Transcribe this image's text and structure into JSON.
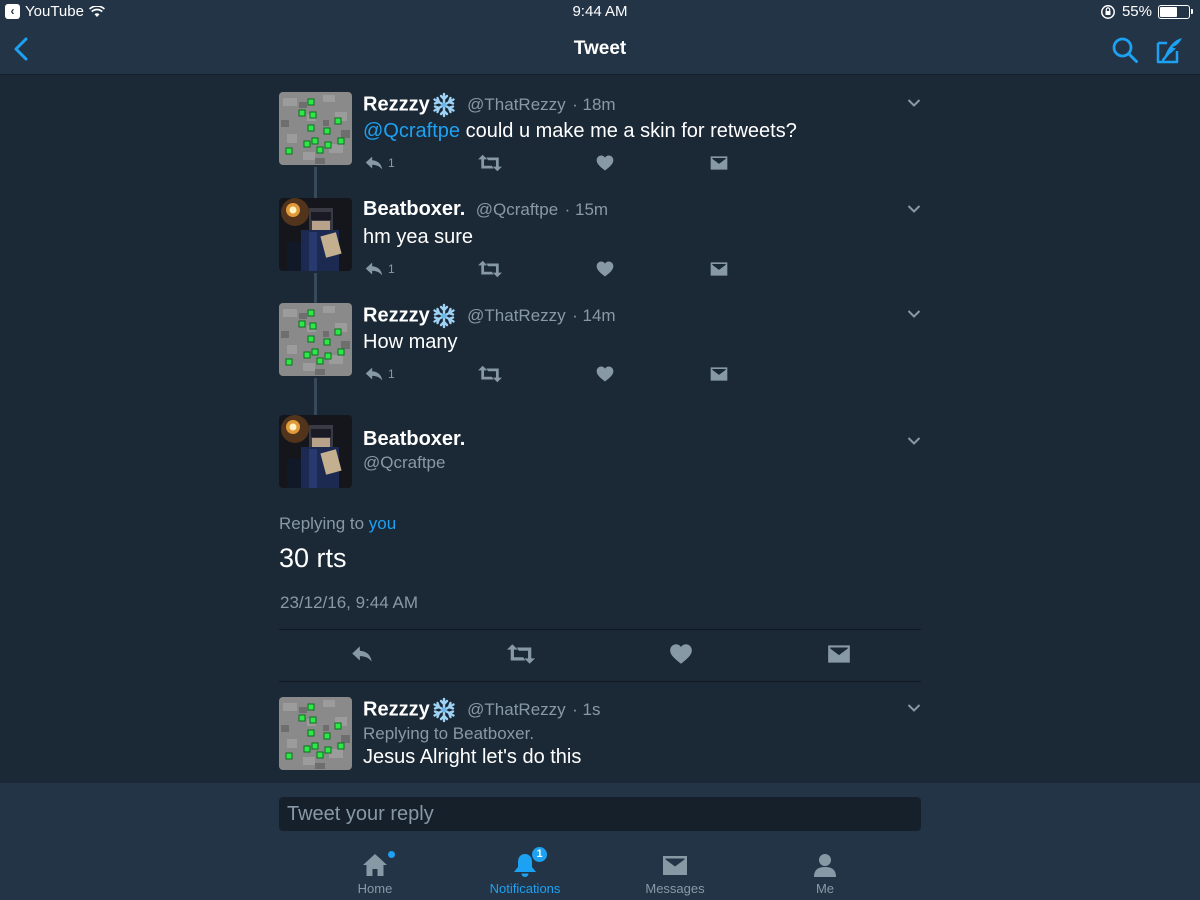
{
  "status_bar": {
    "back_app": "YouTube",
    "time": "9:44 AM",
    "battery": "55%",
    "battery_level": 0.55
  },
  "nav": {
    "title": "Tweet"
  },
  "colors": {
    "accent": "#1da1f2",
    "background": "#1b2836",
    "bar": "#243447",
    "muted": "#8899a6"
  },
  "thread": [
    {
      "name": "Rezzzy",
      "handle": "@ThatRezzy",
      "time": "· 18m",
      "mention": "@Qcraftpe",
      "text": " could u make me a skin for retweets?",
      "reply_count": "1"
    },
    {
      "name": "Beatboxer.",
      "handle": "@Qcraftpe",
      "time": "· 15m",
      "text": "hm yea sure",
      "reply_count": "1"
    },
    {
      "name": "Rezzzy",
      "handle": "@ThatRezzy",
      "time": "· 14m",
      "text": "How many",
      "reply_count": "1"
    }
  ],
  "main_tweet": {
    "name": "Beatboxer.",
    "handle": "@Qcraftpe",
    "replying_prefix": "Replying to",
    "replying_target": "you",
    "text": "30 rts",
    "timestamp": "23/12/16, 9:44 AM"
  },
  "reply_tweet": {
    "name": "Rezzzy",
    "handle": "@ThatRezzy",
    "time": "· 1s",
    "replying": "Replying to Beatboxer.",
    "text": "Jesus Alright let's do this"
  },
  "reply_box": {
    "placeholder": "Tweet your reply"
  },
  "tabs": [
    {
      "label": "Home",
      "icon": "home-icon"
    },
    {
      "label": "Notifications",
      "icon": "bell-icon",
      "badge": "1"
    },
    {
      "label": "Messages",
      "icon": "envelope-icon"
    },
    {
      "label": "Me",
      "icon": "person-icon"
    }
  ]
}
